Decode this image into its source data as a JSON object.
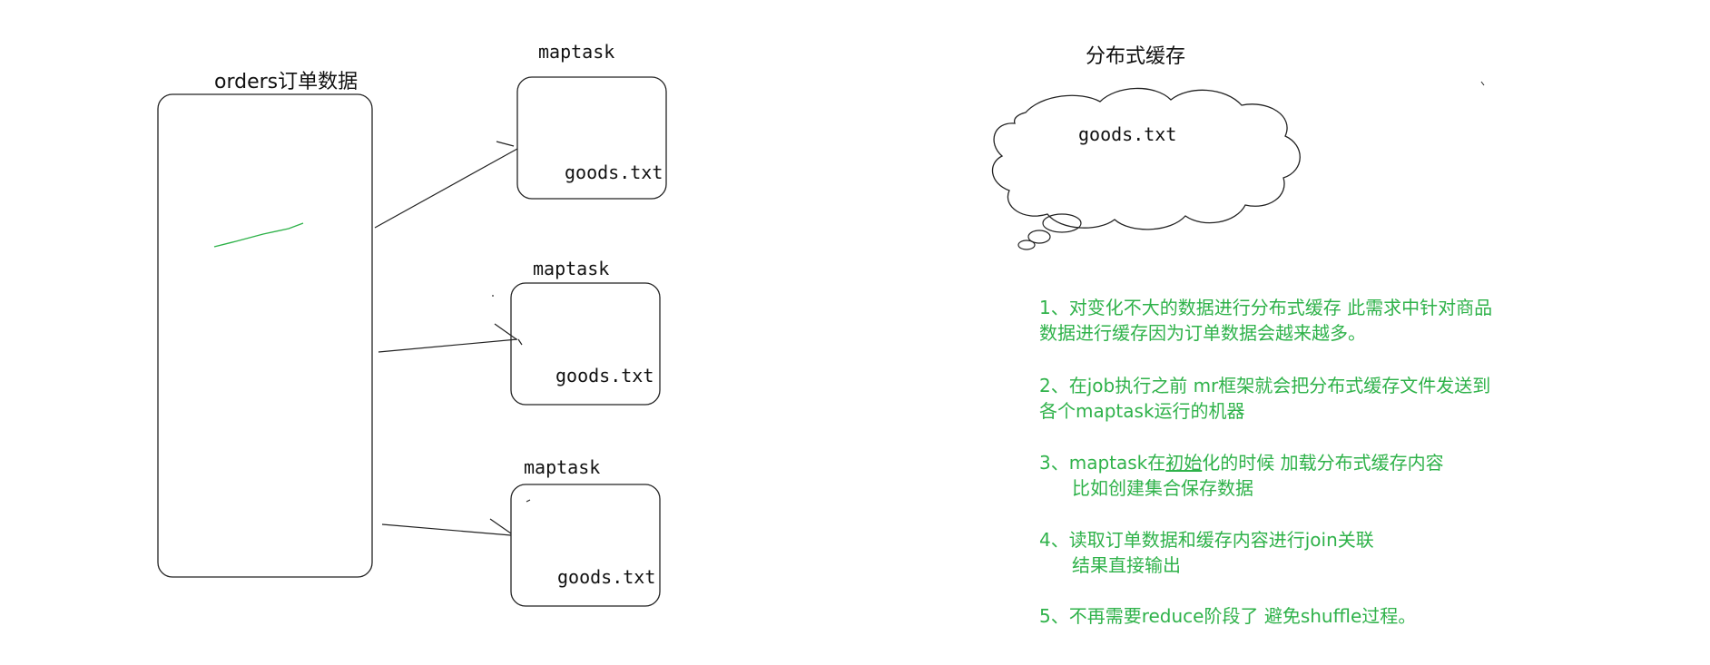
{
  "orders_label": "orders订单数据",
  "maptasks": [
    {
      "title": "maptask",
      "file": "goods.txt"
    },
    {
      "title": "maptask",
      "file": "goods.txt"
    },
    {
      "title": "maptask",
      "file": "goods.txt"
    }
  ],
  "cache": {
    "title": "分布式缓存",
    "file": "goods.txt"
  },
  "notes": [
    {
      "line1": "1、对变化不大的数据进行分布式缓存 此需求中针对商品",
      "line2": "数据进行缓存因为订单数据会越来越多。"
    },
    {
      "line1": "2、在job执行之前  mr框架就会把分布式缓存文件发送到",
      "line2": "各个maptask运行的机器"
    },
    {
      "line1_prefix": "3、maptask在",
      "line1_underlined": "初始",
      "line1_suffix": "化的时候  加载分布式缓存内容",
      "line2": "比如创建集合保存数据"
    },
    {
      "line1": "4、读取订单数据和缓存内容进行join关联",
      "line2": "结果直接输出"
    },
    {
      "line1": "5、不再需要reduce阶段了 避免shuffle过程。"
    }
  ],
  "colors": {
    "stroke": "#222222",
    "note_text": "#2fb24a",
    "scribble": "#2fb24a"
  }
}
